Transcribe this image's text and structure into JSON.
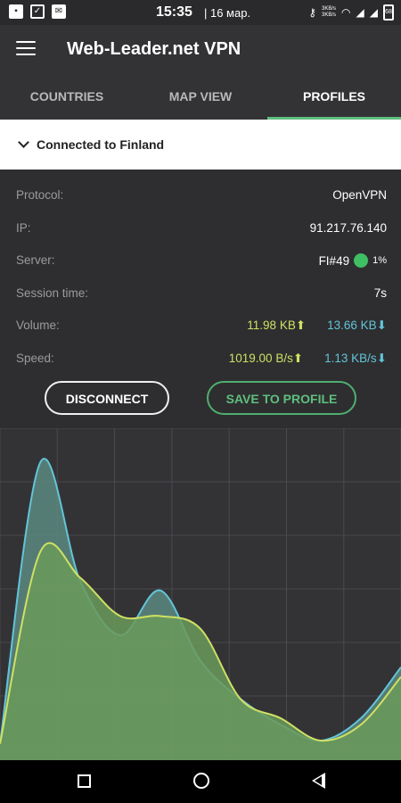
{
  "status_bar": {
    "time": "15:35",
    "date": "| 16 мар.",
    "net_speed_up": "3KB/s",
    "net_speed_down": "3KB/s",
    "battery": "68"
  },
  "app": {
    "title": "Web-Leader.net VPN"
  },
  "tabs": [
    {
      "label": "COUNTRIES",
      "active": false
    },
    {
      "label": "MAP VIEW",
      "active": false
    },
    {
      "label": "PROFILES",
      "active": true
    }
  ],
  "connection": {
    "status": "Connected to Finland"
  },
  "info": {
    "protocol_label": "Protocol:",
    "protocol_value": "OpenVPN",
    "ip_label": "IP:",
    "ip_value": "91.217.76.140",
    "server_label": "Server:",
    "server_value": "FI#49",
    "server_load": "1%",
    "session_label": "Session time:",
    "session_value": "7s",
    "volume_label": "Volume:",
    "volume_up": "11.98 KB",
    "volume_down": "13.66 KB",
    "speed_label": "Speed:",
    "speed_up": "1019.00 B/s",
    "speed_down": "1.13 KB/s"
  },
  "buttons": {
    "disconnect": "DISCONNECT",
    "save_profile": "SAVE TO PROFILE"
  },
  "graph": {
    "colors": {
      "download": "#63c4d8",
      "upload": "#cfe063",
      "fill_up": "#6b9a5a",
      "fill_down": "#5a8a80"
    },
    "download_series": [
      0.04,
      0.92,
      0.55,
      0.38,
      0.52,
      0.3,
      0.18,
      0.1,
      0.05,
      0.12,
      0.28
    ],
    "upload_series": [
      0.04,
      0.64,
      0.56,
      0.44,
      0.44,
      0.4,
      0.18,
      0.12,
      0.05,
      0.1,
      0.25
    ]
  }
}
